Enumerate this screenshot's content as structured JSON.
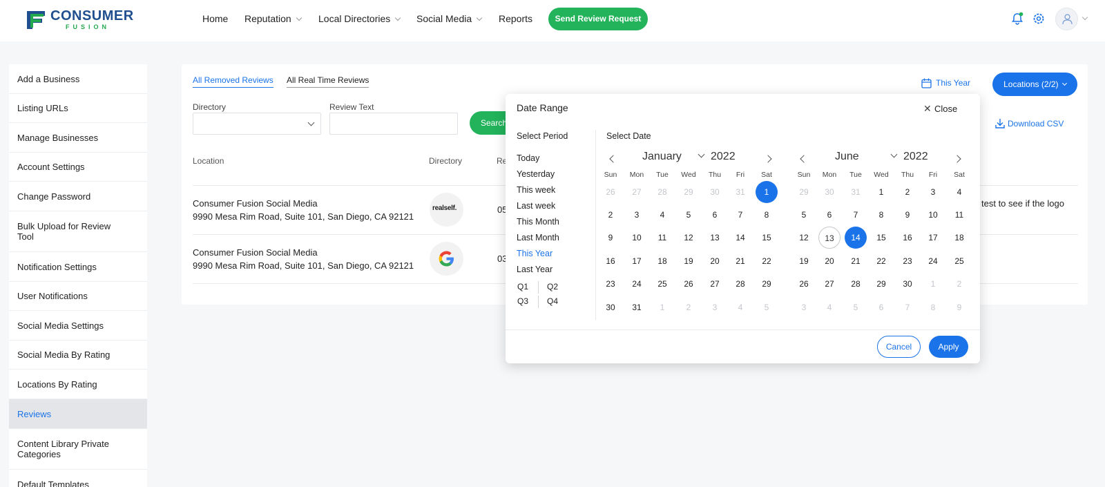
{
  "header": {
    "logo_word1": "CONSUMER",
    "logo_word2": "FUSION",
    "nav": [
      {
        "label": "Home",
        "dropdown": false
      },
      {
        "label": "Reputation",
        "dropdown": true
      },
      {
        "label": "Local Directories",
        "dropdown": true
      },
      {
        "label": "Social Media",
        "dropdown": true
      },
      {
        "label": "Reports",
        "dropdown": false
      }
    ],
    "send_review_request": "Send Review Request",
    "icons": [
      "bell-icon",
      "gear-icon",
      "user-icon"
    ]
  },
  "sidebar": {
    "items": [
      {
        "label": "Add a Business"
      },
      {
        "label": "Listing URLs"
      },
      {
        "label": "Manage Businesses"
      },
      {
        "label": "Account Settings"
      },
      {
        "label": "Change Password"
      },
      {
        "label": "Bulk Upload for Review Tool"
      },
      {
        "label": "Notification Settings"
      },
      {
        "label": "User Notifications"
      },
      {
        "label": "Social Media Settings"
      },
      {
        "label": "Social Media By Rating"
      },
      {
        "label": "Locations By Rating"
      },
      {
        "label": "Reviews",
        "active": true
      },
      {
        "label": "Content Library Private Categories"
      },
      {
        "label": "Default Templates"
      }
    ]
  },
  "main": {
    "tabs": [
      {
        "label": "All Removed Reviews",
        "active": true
      },
      {
        "label": "All Real Time Reviews",
        "active": false
      }
    ],
    "filters": {
      "directory_label": "Directory",
      "directory_value": "",
      "review_text_label": "Review Text",
      "review_text_value": "",
      "search_label": "Search"
    },
    "date_filter": "This Year",
    "locations_button": "Locations (2/2)",
    "download_csv": "Download CSV",
    "columns": [
      "Location",
      "Directory",
      "Re"
    ],
    "rows": [
      {
        "location_name": "Consumer Fusion Social Media",
        "location_address": "9990 Mesa Rim Road, Suite 101, San Diego, CA 92121",
        "directory": "realself",
        "directory_logo_text": "realself.",
        "date_fragment": "05",
        "text_fragment": "test to see if the logo"
      },
      {
        "location_name": "Consumer Fusion Social Media",
        "location_address": "9990 Mesa Rim Road, Suite 101, San Diego, CA 92121",
        "directory": "google",
        "directory_logo_text": "G",
        "date_fragment": "03",
        "text_fragment": ""
      }
    ]
  },
  "date_range": {
    "title": "Date Range",
    "close_label": "Close",
    "select_period_label": "Select Period",
    "select_date_label": "Select Date",
    "periods": [
      {
        "label": "Today"
      },
      {
        "label": "Yesterday"
      },
      {
        "label": "This week"
      },
      {
        "label": "Last week"
      },
      {
        "label": "This Month"
      },
      {
        "label": "Last Month"
      },
      {
        "label": "This Year",
        "active": true
      },
      {
        "label": "Last Year"
      }
    ],
    "quarters": [
      "Q1",
      "Q2",
      "Q3",
      "Q4"
    ],
    "weekdays": [
      "Sun",
      "Mon",
      "Tue",
      "Wed",
      "Thu",
      "Fri",
      "Sat"
    ],
    "calendars": [
      {
        "month": "January",
        "year": "2022",
        "weeks": [
          [
            [
              "26",
              "m"
            ],
            [
              "27",
              "m"
            ],
            [
              "28",
              "m"
            ],
            [
              "29",
              "m"
            ],
            [
              "30",
              "m"
            ],
            [
              "31",
              "m"
            ],
            [
              "1",
              "s"
            ]
          ],
          [
            [
              "2",
              ""
            ],
            [
              "3",
              ""
            ],
            [
              "4",
              ""
            ],
            [
              "5",
              ""
            ],
            [
              "6",
              ""
            ],
            [
              "7",
              ""
            ],
            [
              "8",
              ""
            ]
          ],
          [
            [
              "9",
              ""
            ],
            [
              "10",
              ""
            ],
            [
              "11",
              ""
            ],
            [
              "12",
              ""
            ],
            [
              "13",
              ""
            ],
            [
              "14",
              ""
            ],
            [
              "15",
              ""
            ]
          ],
          [
            [
              "16",
              ""
            ],
            [
              "17",
              ""
            ],
            [
              "18",
              ""
            ],
            [
              "19",
              ""
            ],
            [
              "20",
              ""
            ],
            [
              "21",
              ""
            ],
            [
              "22",
              ""
            ]
          ],
          [
            [
              "23",
              ""
            ],
            [
              "24",
              ""
            ],
            [
              "25",
              ""
            ],
            [
              "26",
              ""
            ],
            [
              "27",
              ""
            ],
            [
              "28",
              ""
            ],
            [
              "29",
              ""
            ]
          ],
          [
            [
              "30",
              ""
            ],
            [
              "31",
              ""
            ],
            [
              "1",
              "m"
            ],
            [
              "2",
              "m"
            ],
            [
              "3",
              "m"
            ],
            [
              "4",
              "m"
            ],
            [
              "5",
              "m"
            ]
          ]
        ]
      },
      {
        "month": "June",
        "year": "2022",
        "weeks": [
          [
            [
              "29",
              "m"
            ],
            [
              "30",
              "m"
            ],
            [
              "31",
              "m"
            ],
            [
              "1",
              ""
            ],
            [
              "2",
              ""
            ],
            [
              "3",
              ""
            ],
            [
              "4",
              ""
            ]
          ],
          [
            [
              "5",
              ""
            ],
            [
              "6",
              ""
            ],
            [
              "7",
              ""
            ],
            [
              "8",
              ""
            ],
            [
              "9",
              ""
            ],
            [
              "10",
              ""
            ],
            [
              "11",
              ""
            ]
          ],
          [
            [
              "12",
              ""
            ],
            [
              "13",
              "t"
            ],
            [
              "14",
              "s"
            ],
            [
              "15",
              ""
            ],
            [
              "16",
              ""
            ],
            [
              "17",
              ""
            ],
            [
              "18",
              ""
            ]
          ],
          [
            [
              "19",
              ""
            ],
            [
              "20",
              ""
            ],
            [
              "21",
              ""
            ],
            [
              "22",
              ""
            ],
            [
              "23",
              ""
            ],
            [
              "24",
              ""
            ],
            [
              "25",
              ""
            ]
          ],
          [
            [
              "26",
              ""
            ],
            [
              "27",
              ""
            ],
            [
              "28",
              ""
            ],
            [
              "29",
              ""
            ],
            [
              "30",
              ""
            ],
            [
              "1",
              "m"
            ],
            [
              "2",
              "m"
            ]
          ],
          [
            [
              "3",
              "m"
            ],
            [
              "4",
              "m"
            ],
            [
              "5",
              "m"
            ],
            [
              "6",
              "m"
            ],
            [
              "7",
              "m"
            ],
            [
              "8",
              "m"
            ],
            [
              "9",
              "m"
            ]
          ]
        ]
      }
    ],
    "cancel_label": "Cancel",
    "apply_label": "Apply"
  },
  "colors": {
    "accent": "#1a73e8",
    "brand_green": "#22b35b",
    "brand_navy": "#1f4f8f"
  }
}
